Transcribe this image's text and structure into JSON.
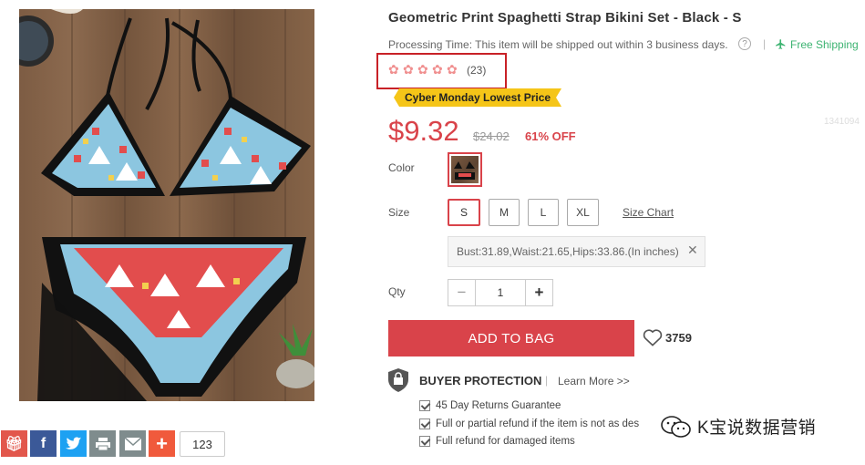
{
  "product": {
    "title": "Geometric Print Spaghetti Strap Bikini Set - Black - S",
    "processing_time": "Processing Time: This item will be shipped out within 3 business days.",
    "help_glyph": "?",
    "separator": "|",
    "free_shipping": "Free Shipping",
    "rating_stars": 5,
    "review_count": "(23)",
    "promo_tag": "Cyber Monday Lowest Price",
    "faint_id": "1341094",
    "price": "$9.32",
    "old_price": "$24.02",
    "discount": "61% OFF"
  },
  "options": {
    "color_label": "Color",
    "size_label": "Size",
    "sizes": [
      "S",
      "M",
      "L",
      "XL"
    ],
    "selected_size": "S",
    "size_chart": "Size Chart",
    "measurements": "Bust:31.89,Waist:21.65,Hips:33.86.(In inches)",
    "close_glyph": "✕",
    "qty_label": "Qty",
    "qty_minus": "−",
    "qty_value": "1",
    "qty_plus": "+"
  },
  "actions": {
    "add_to_bag": "ADD TO BAG",
    "wishlist_count": "3759"
  },
  "buyer_protection": {
    "title": "BUYER PROTECTION",
    "separator": "|",
    "learn_more": "Learn More >>",
    "items": [
      "45 Day Returns Guarantee",
      "Full or partial refund if the item is not as des",
      "Full refund for damaged items"
    ]
  },
  "share": {
    "count": "123",
    "colors": {
      "gift": "#e2574c",
      "facebook": "#3b5998",
      "twitter": "#1da1f2",
      "print": "#7f8c8d",
      "email": "#7f8c8d",
      "more": "#f05a3c"
    }
  },
  "watermark": {
    "text": "K宝说数据营销"
  },
  "colors": {
    "accent": "#d9434a",
    "rating_box": "#c82127",
    "promo": "#f5c518",
    "free_shipping": "#3cb371"
  }
}
